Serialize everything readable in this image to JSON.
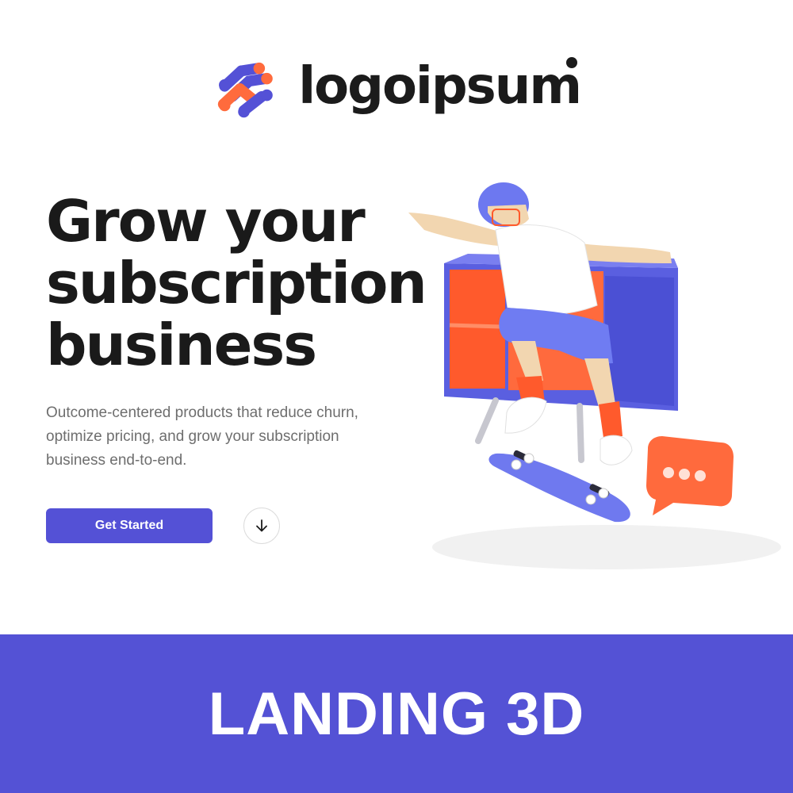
{
  "brand": {
    "name": "logoipsum",
    "colors": {
      "primary": "#5451d6",
      "accent": "#ff6b3d",
      "text": "#1b1b1b"
    }
  },
  "hero": {
    "headline": [
      "Grow your",
      "subscription",
      "business"
    ],
    "subtitle": "Outcome-centered products that reduce churn, optimize pricing, and grow your subscription business end-to-end.",
    "cta_label": "Get Started",
    "scroll_icon": "arrow-down-icon"
  },
  "illustration": {
    "description_icon": "skater-3d-illustration",
    "elements": [
      "skater",
      "cabinet",
      "skateboard",
      "chat-bubble"
    ]
  },
  "banner": {
    "text": "LANDING 3D"
  }
}
